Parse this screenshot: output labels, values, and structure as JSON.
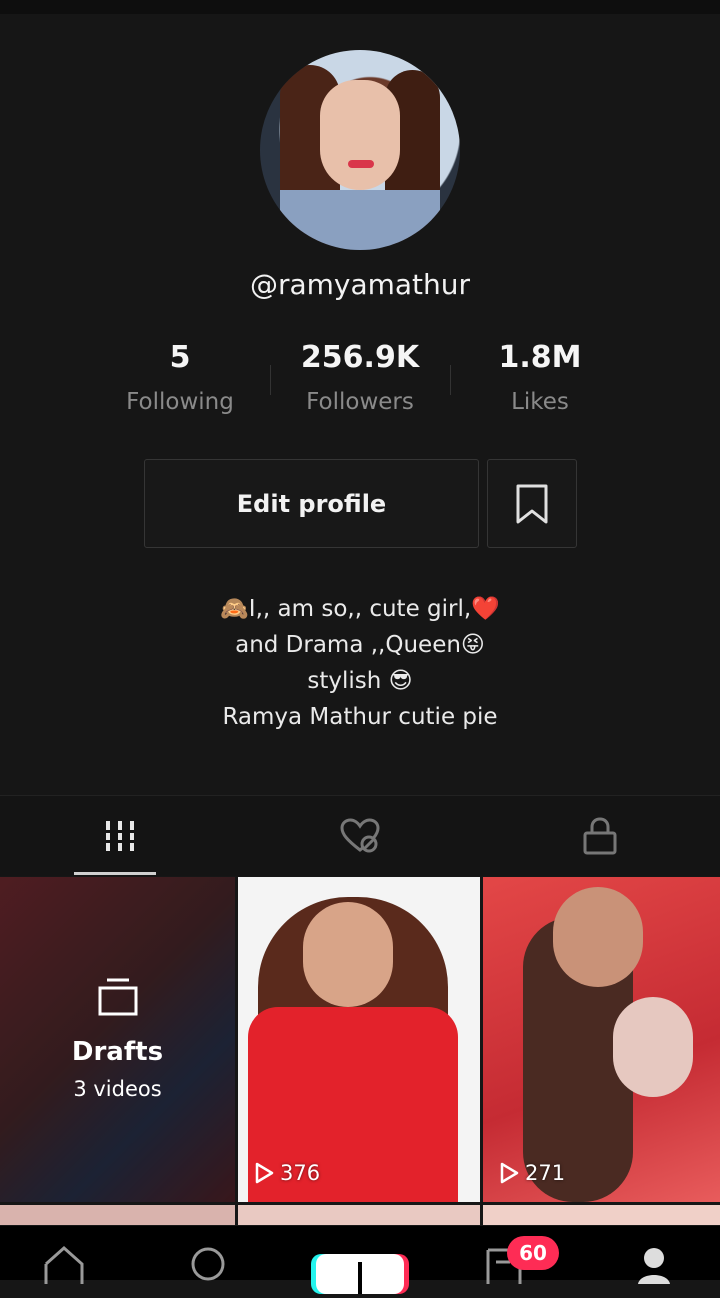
{
  "profile": {
    "username": "@ramyamathur",
    "stats": [
      {
        "value": "5",
        "label": "Following"
      },
      {
        "value": "256.9K",
        "label": "Followers"
      },
      {
        "value": "1.8M",
        "label": "Likes"
      }
    ],
    "edit_label": "Edit profile",
    "bio": [
      "🙈I,, am so,, cute girl,❤️",
      "and Drama ,,Queen😝",
      "stylish 😎",
      "Ramya Mathur cutie pie"
    ]
  },
  "tabs": [
    {
      "icon": "grid-icon",
      "active": true
    },
    {
      "icon": "liked-hidden-icon",
      "active": false
    },
    {
      "icon": "lock-icon",
      "active": false
    }
  ],
  "grid": {
    "drafts": {
      "title": "Drafts",
      "count": "3 videos"
    },
    "videos": [
      {
        "views": "376"
      },
      {
        "views": "271"
      }
    ]
  },
  "bottom_nav": {
    "inbox_badge": "60",
    "icons": [
      "home-icon",
      "discover-icon",
      "create-icon",
      "inbox-icon",
      "profile-icon"
    ]
  },
  "colors": {
    "accent": "#fe2c55",
    "secondary": "#25f4ee",
    "background": "#161616"
  }
}
